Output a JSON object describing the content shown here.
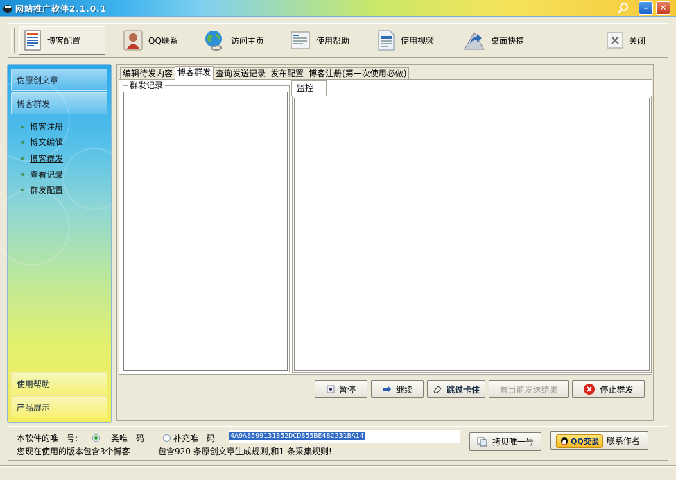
{
  "window": {
    "title": "网站推广软件2.1.0.1"
  },
  "toolbar": {
    "items": [
      {
        "label": "博客配置"
      },
      {
        "label": "QQ联系"
      },
      {
        "label": "访问主页"
      },
      {
        "label": "使用帮助"
      },
      {
        "label": "使用视频"
      },
      {
        "label": "桌面快捷"
      },
      {
        "label": "关闭"
      }
    ]
  },
  "sidebar": {
    "sections": [
      {
        "label": "伪原创文章"
      },
      {
        "label": "博客群发"
      }
    ],
    "items": [
      {
        "label": "博客注册"
      },
      {
        "label": "博文编辑"
      },
      {
        "label": "博客群发"
      },
      {
        "label": "查看记录"
      },
      {
        "label": "群发配置"
      }
    ],
    "bottom_sections": [
      {
        "label": "使用帮助"
      },
      {
        "label": "产品展示"
      }
    ]
  },
  "main": {
    "tabs": [
      {
        "label": "编辑待发内容"
      },
      {
        "label": "博客群发"
      },
      {
        "label": "查询发送记录"
      },
      {
        "label": "发布配置"
      },
      {
        "label": "博客注册(第一次使用必做)"
      }
    ],
    "group_title": "群发记录",
    "subtab": "监控",
    "buttons": {
      "pause": "暂停",
      "resume": "继续",
      "skip": "跳过卡住",
      "view_result": "看当前发送结果",
      "stop": "停止群发"
    }
  },
  "status": {
    "uid_label": "本软件的唯一号:",
    "radio_1": "一类唯一码",
    "radio_2": "补充唯一码",
    "uid_value": "4A9A8599131852DCD855BE482231BA14",
    "copy_button": "拷贝唯一号",
    "qq_badge": "QQ交谈",
    "contact_author": "联系作者",
    "version_info": "您现在使用的版本包含3个博客",
    "rules_info": "包含920 条原创文章生成规则,和1 条采集规则!"
  }
}
